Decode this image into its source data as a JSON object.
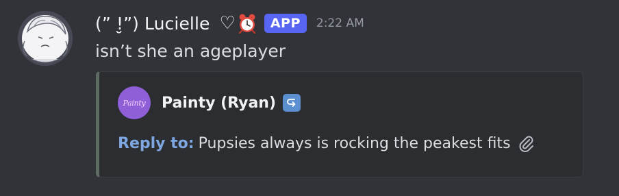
{
  "message": {
    "author": {
      "name": "(ˮ !̮ˮ) Lucielle",
      "heart_emoji": "♡",
      "alarm_emoji": "alarm-clock-emoji",
      "badge": "APP"
    },
    "timestamp": "2:22 AM",
    "content": "isn’t she an ageplayer"
  },
  "embed": {
    "author_name": "Painty (Ryan)",
    "author_avatar_text": "Painty",
    "author_icon": "reply-arrow-icon",
    "reply_label": "Reply to:",
    "reply_text": "Pupsies always is rocking the peakest fits",
    "attachment_icon": "paperclip-icon",
    "accent_color": "#5e6b62"
  },
  "colors": {
    "background": "#313338",
    "embed_background": "#2b2d31",
    "app_badge": "#5865f2",
    "reply_label": "#7ea6e0",
    "timestamp": "#949ba4"
  }
}
